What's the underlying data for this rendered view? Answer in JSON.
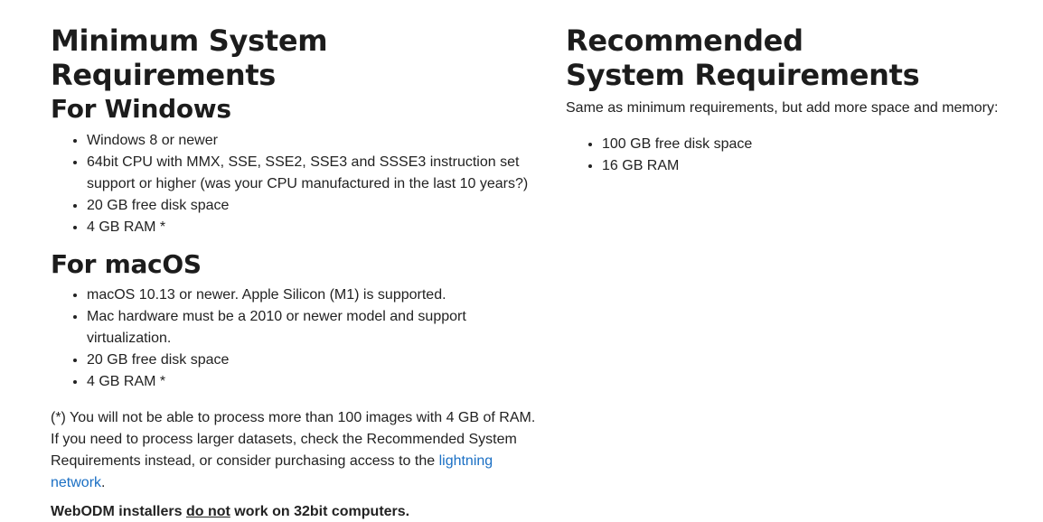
{
  "minimum": {
    "title": "Minimum System Requirements",
    "windows": {
      "heading": "For Windows",
      "items": [
        "Windows 8 or newer",
        "64bit CPU with MMX, SSE, SSE2, SSE3 and SSSE3 instruction set support or higher (was your CPU manufactured in the last 10 years?)",
        "20 GB free disk space",
        "4 GB RAM *"
      ]
    },
    "macos": {
      "heading": "For macOS",
      "items": [
        "macOS 10.13 or newer. Apple Silicon (M1) is supported.",
        "Mac hardware must be a 2010 or newer model and support virtualization.",
        "20 GB free disk space",
        "4 GB RAM *"
      ]
    },
    "footnote": {
      "text": "(*) You will not be able to process more than 100 images with 4 GB of RAM. If you need to process larger datasets, check the Recommended System Requirements instead, or consider purchasing access to the",
      "link_label": "lightning network",
      "end": "."
    },
    "warning": {
      "before": "WebODM installers",
      "emphasis": "do not",
      "after": "work on 32bit computers."
    }
  },
  "recommended": {
    "title": "Recommended System Requirements",
    "intro": "Same as minimum requirements, but add more space and memory:",
    "items": [
      "100 GB free disk space",
      "16 GB RAM"
    ]
  },
  "colors": {
    "text": "#222222",
    "link": "#1a6fc4"
  }
}
